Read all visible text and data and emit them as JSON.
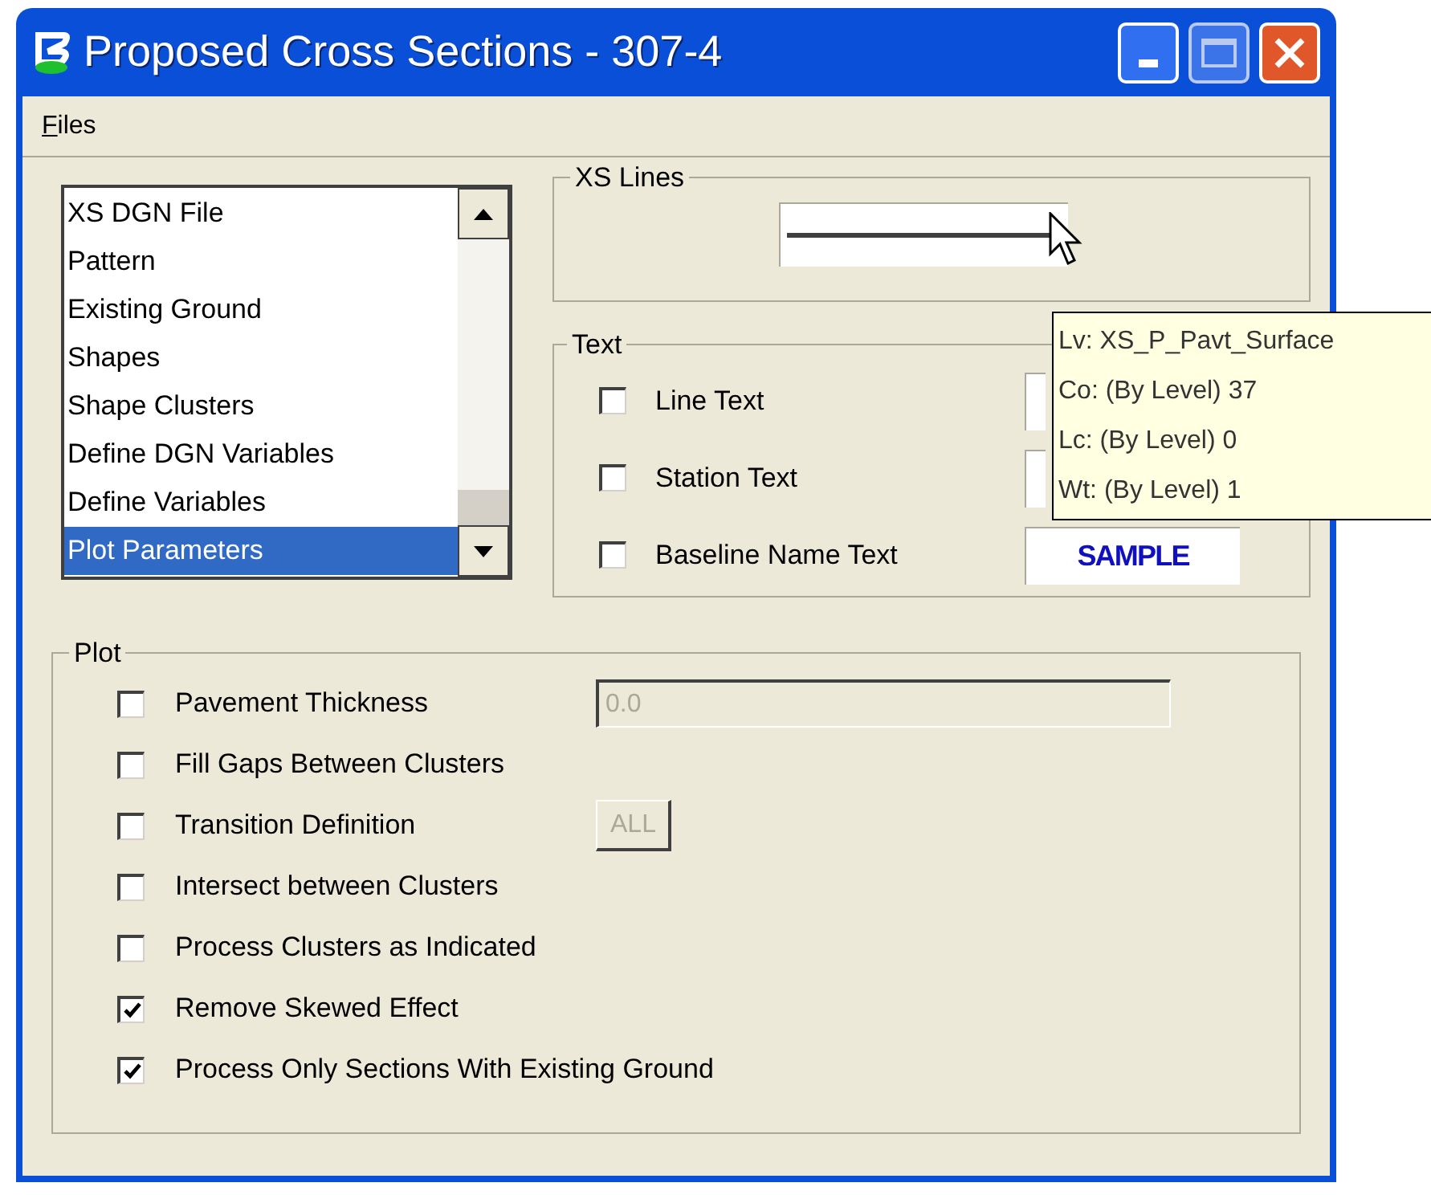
{
  "window": {
    "title": "Proposed Cross Sections - 307-4"
  },
  "menu": [
    {
      "label": "Files"
    }
  ],
  "list": {
    "items": [
      {
        "label": "XS DGN File",
        "selected": false
      },
      {
        "label": "Pattern",
        "selected": false
      },
      {
        "label": "Existing Ground",
        "selected": false
      },
      {
        "label": "Shapes",
        "selected": false
      },
      {
        "label": "Shape Clusters",
        "selected": false
      },
      {
        "label": "Define DGN Variables",
        "selected": false
      },
      {
        "label": "Define Variables",
        "selected": false
      },
      {
        "label": "Plot Parameters",
        "selected": true
      }
    ]
  },
  "xs_lines": {
    "title": "XS Lines"
  },
  "text_group": {
    "title": "Text",
    "rows": [
      {
        "label": "Line Text",
        "checked": false,
        "kind": "blank"
      },
      {
        "label": "Station Text",
        "checked": false,
        "kind": "blank"
      },
      {
        "label": "Baseline Name Text",
        "checked": false,
        "kind": "sample",
        "sample": "SAMPLE"
      }
    ]
  },
  "tooltip": {
    "lines": [
      "Lv: XS_P_Pavt_Surface",
      "Co: (By Level) 37",
      "Lc: (By Level) 0",
      "Wt: (By Level) 1"
    ]
  },
  "plot": {
    "title": "Plot",
    "rows": [
      {
        "label": "Pavement Thickness",
        "checked": false,
        "kind": "field",
        "value": "0.0",
        "disabled": true
      },
      {
        "label": "Fill Gaps Between Clusters",
        "checked": false,
        "kind": "plain"
      },
      {
        "label": "Transition Definition",
        "checked": false,
        "kind": "button",
        "value": "ALL",
        "disabled": true
      },
      {
        "label": "Intersect between Clusters",
        "checked": false,
        "kind": "plain"
      },
      {
        "label": "Process Clusters as Indicated",
        "checked": false,
        "kind": "plain"
      },
      {
        "label": "Remove Skewed Effect",
        "checked": true,
        "kind": "plain"
      },
      {
        "label": "Process Only Sections With Existing Ground",
        "checked": true,
        "kind": "plain"
      }
    ]
  }
}
